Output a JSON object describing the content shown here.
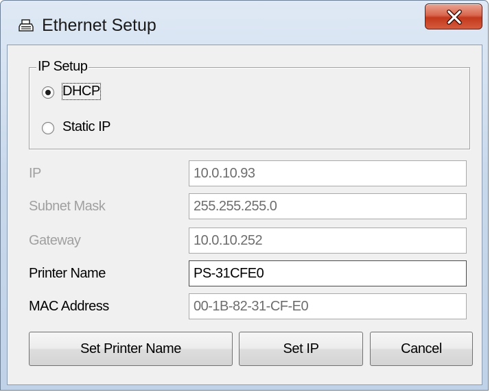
{
  "window": {
    "title": "Ethernet Setup",
    "close_label": "X"
  },
  "ip_setup": {
    "legend": "IP Setup",
    "options": [
      {
        "label": "DHCP",
        "selected": true
      },
      {
        "label": "Static IP",
        "selected": false
      }
    ]
  },
  "fields": [
    {
      "label": "IP",
      "value": "10.0.10.93",
      "state": "disabled"
    },
    {
      "label": "Subnet Mask",
      "value": "255.255.255.0",
      "state": "disabled"
    },
    {
      "label": "Gateway",
      "value": "10.0.10.252",
      "state": "disabled"
    },
    {
      "label": "Printer Name",
      "value": "PS-31CFE0",
      "state": "enabled"
    },
    {
      "label": "MAC Address",
      "value": "00-1B-82-31-CF-E0",
      "state": "readonly"
    }
  ],
  "buttons": {
    "set_printer_name": "Set Printer Name",
    "set_ip": "Set IP",
    "cancel": "Cancel"
  },
  "icons": {
    "title_icon": "printer-icon",
    "close_icon": "close-icon"
  },
  "colors": {
    "close_button": "#c3391c",
    "disabled_text": "#a0a0a0"
  }
}
